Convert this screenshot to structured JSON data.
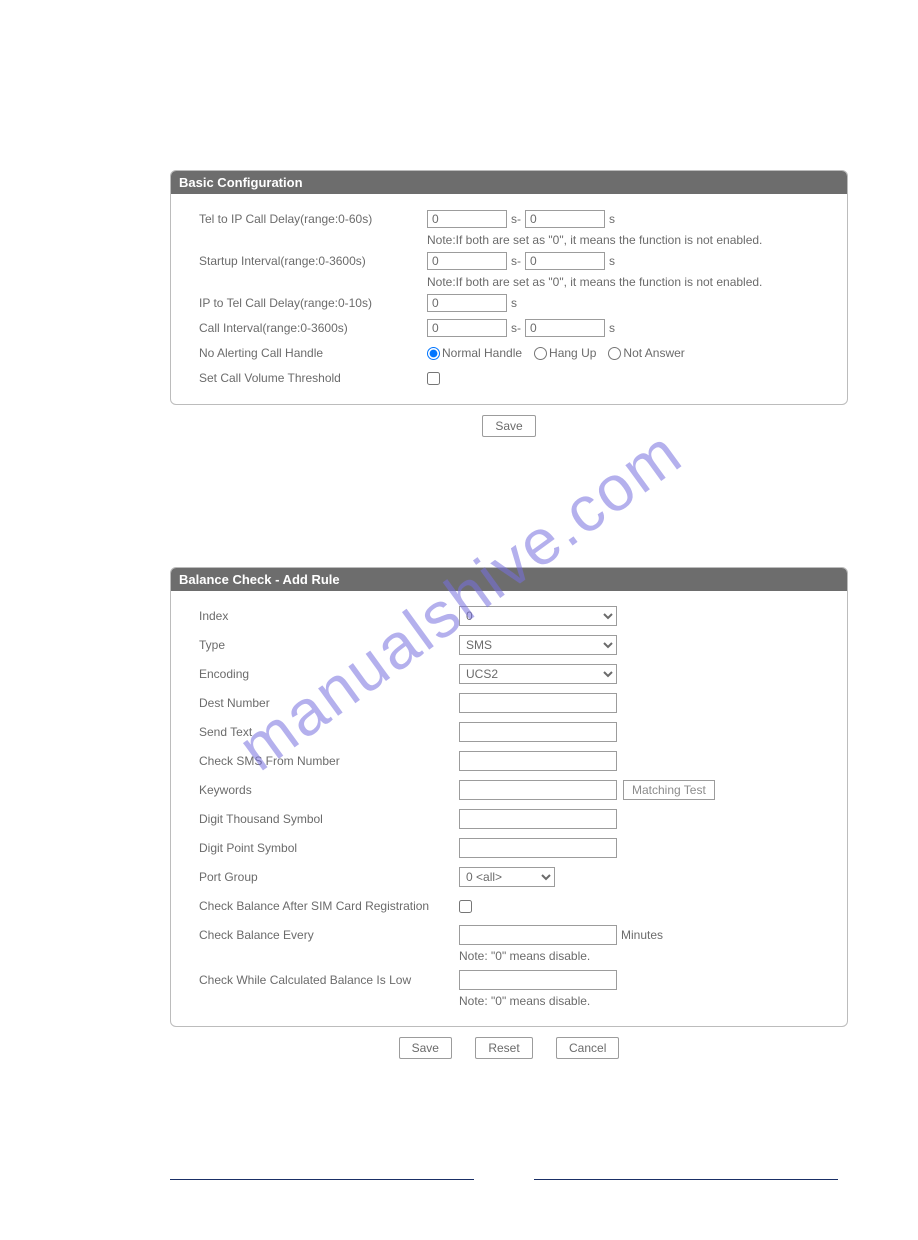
{
  "watermark": "manualshive.com",
  "panel1": {
    "title": "Basic Configuration",
    "rows": {
      "tel_to_ip": {
        "label": "Tel to IP Call Delay(range:0-60s)",
        "v1": "0",
        "sep": "s-",
        "v2": "0",
        "unit": "s",
        "note": "Note:If both are set as \"0\", it means the function is not enabled."
      },
      "startup": {
        "label": "Startup Interval(range:0-3600s)",
        "v1": "0",
        "sep": "s-",
        "v2": "0",
        "unit": "s",
        "note": "Note:If both are set as \"0\", it means the function is not enabled."
      },
      "ip_to_tel": {
        "label": "IP to Tel Call Delay(range:0-10s)",
        "v1": "0",
        "unit": "s"
      },
      "call_int": {
        "label": "Call Interval(range:0-3600s)",
        "v1": "0",
        "sep": "s-",
        "v2": "0",
        "unit": "s"
      },
      "no_alert": {
        "label": "No Alerting Call Handle",
        "opt1": "Normal Handle",
        "opt2": "Hang Up",
        "opt3": "Not Answer"
      },
      "vol_thresh": {
        "label": "Set Call Volume Threshold"
      }
    },
    "save_btn": "Save"
  },
  "panel2": {
    "title": "Balance Check - Add Rule",
    "rows": {
      "index": {
        "label": "Index",
        "value": "0"
      },
      "type": {
        "label": "Type",
        "value": "SMS"
      },
      "encoding": {
        "label": "Encoding",
        "value": "UCS2"
      },
      "dest": {
        "label": "Dest Number",
        "value": ""
      },
      "send_text": {
        "label": "Send Text",
        "value": ""
      },
      "check_from": {
        "label": "Check SMS From Number",
        "value": ""
      },
      "keywords": {
        "label": "Keywords",
        "value": "",
        "btn": "Matching Test"
      },
      "thousand": {
        "label": "Digit Thousand Symbol",
        "value": ""
      },
      "point": {
        "label": "Digit Point Symbol",
        "value": ""
      },
      "port_group": {
        "label": "Port Group",
        "value": "0 <all>"
      },
      "after_reg": {
        "label": "Check Balance After SIM Card Registration"
      },
      "every": {
        "label": "Check Balance Every",
        "value": "",
        "unit": "Minutes",
        "note": "Note: \"0\" means disable."
      },
      "low": {
        "label": "Check While Calculated Balance Is Low",
        "value": "",
        "note": "Note: \"0\" means disable."
      }
    },
    "buttons": {
      "save": "Save",
      "reset": "Reset",
      "cancel": "Cancel"
    }
  }
}
